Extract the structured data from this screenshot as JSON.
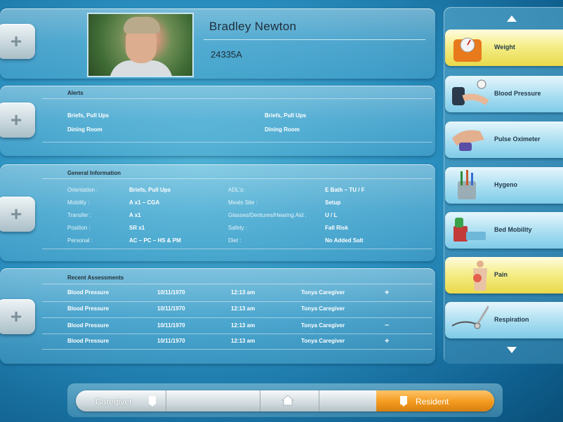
{
  "resident": {
    "name": "Bradley Newton",
    "id": "24335A"
  },
  "alerts": {
    "title": "Alerts",
    "left": [
      "Briefs, Pull Ups",
      "Dining Room"
    ],
    "right": [
      "Briefs, Pull Ups",
      "Dining Room"
    ]
  },
  "general": {
    "title": "General Information",
    "left": [
      {
        "label": "Orientation :",
        "value": "Briefs, Pull Ups"
      },
      {
        "label": "Mobility :",
        "value": "A x1   –   CGA"
      },
      {
        "label": "Transfer :",
        "value": "A x1"
      },
      {
        "label": "Position :",
        "value": "SR x1"
      },
      {
        "label": "Personal :",
        "value": "AC   –   PC   –   HS & PM"
      }
    ],
    "right": [
      {
        "label": "ADL's:",
        "value": "E Bath   –   TU / F"
      },
      {
        "label": "Meals Site :",
        "value": "Setup"
      },
      {
        "label": "Glasses/Dentures/Hearing Aid :",
        "value": "U / L"
      },
      {
        "label": "Safety :",
        "value": "Fall Risk"
      },
      {
        "label": "Diet :",
        "value": "No Added Salt"
      }
    ]
  },
  "assessments": {
    "title": "Recent Assessments",
    "rows": [
      {
        "type": "Blood Pressure",
        "date": "10/11/1970",
        "time": "12:13 am",
        "caregiver": "Tonya Caregiver",
        "mark": "+"
      },
      {
        "type": "Blood Pressure",
        "date": "10/11/1970",
        "time": "12:13 am",
        "caregiver": "Tonya Caregiver",
        "mark": ""
      },
      {
        "type": "Blood Pressure",
        "date": "10/11/1970",
        "time": "12:13 am",
        "caregiver": "Tonya Caregiver",
        "mark": "–"
      },
      {
        "type": "Blood Pressure",
        "date": "10/11/1970",
        "time": "12:13 am",
        "caregiver": "Tonya Caregiver",
        "mark": "+"
      }
    ]
  },
  "plus_glyph": "+",
  "sidebar": {
    "items": [
      {
        "label": "Weight",
        "icon": "scale-icon",
        "active": true
      },
      {
        "label": "Blood Pressure",
        "icon": "blood-pressure-cuff-icon",
        "active": false
      },
      {
        "label": "Pulse Oximeter",
        "icon": "pulse-oximeter-icon",
        "active": false
      },
      {
        "label": "Hygeno",
        "icon": "toothbrush-cup-icon",
        "active": false
      },
      {
        "label": "Bed Mobility",
        "icon": "bed-icon",
        "active": false
      },
      {
        "label": "Pain",
        "icon": "back-pain-icon",
        "active": true
      },
      {
        "label": "Respiration",
        "icon": "stethoscope-icon",
        "active": false
      }
    ]
  },
  "bottom_nav": {
    "caregiver_label": "Caregiver",
    "resident_label": "Resident"
  },
  "colors": {
    "active_yellow": "#f5ee8a",
    "resident_orange": "#f29a1e",
    "background_blue": "#2a8fbf"
  }
}
